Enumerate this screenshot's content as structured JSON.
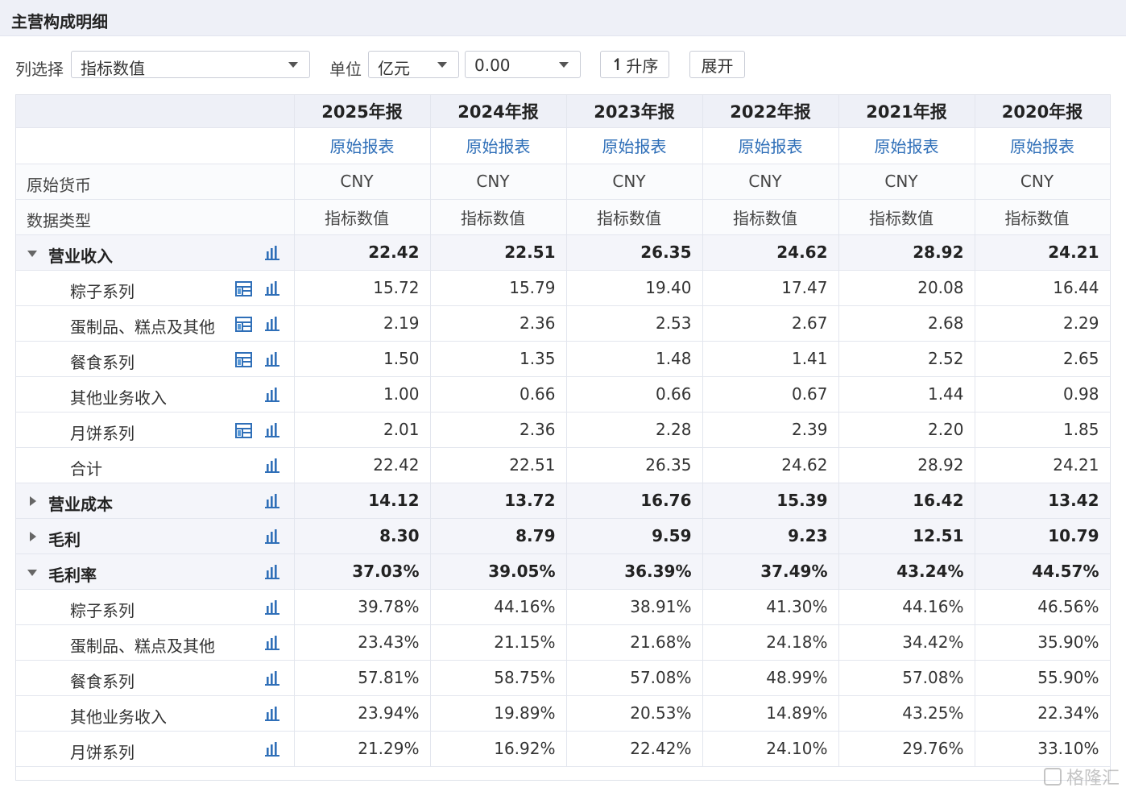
{
  "page_title": "主营构成明细",
  "toolbar": {
    "column_label": "列选择",
    "column_value": "指标数值",
    "unit_label": "单位",
    "unit_value": "亿元",
    "format_value": "0.00",
    "sort_label": "升序",
    "expand_label": "展开"
  },
  "columns": [
    "2025年报",
    "2024年报",
    "2023年报",
    "2022年报",
    "2021年报",
    "2020年报"
  ],
  "link_label": "原始报表",
  "info_rows": [
    {
      "label": "原始货币",
      "values": [
        "CNY",
        "CNY",
        "CNY",
        "CNY",
        "CNY",
        "CNY"
      ]
    },
    {
      "label": "数据类型",
      "values": [
        "指标数值",
        "指标数值",
        "指标数值",
        "指标数值",
        "指标数值",
        "指标数值"
      ]
    }
  ],
  "rows": [
    {
      "kind": "group",
      "toggle": "down",
      "label": "营业收入",
      "pie": false,
      "values": [
        "22.42",
        "22.51",
        "26.35",
        "24.62",
        "28.92",
        "24.21"
      ]
    },
    {
      "kind": "child",
      "label": "粽子系列",
      "pie": true,
      "values": [
        "15.72",
        "15.79",
        "19.40",
        "17.47",
        "20.08",
        "16.44"
      ]
    },
    {
      "kind": "child",
      "label": "蛋制品、糕点及其他",
      "pie": true,
      "values": [
        "2.19",
        "2.36",
        "2.53",
        "2.67",
        "2.68",
        "2.29"
      ]
    },
    {
      "kind": "child",
      "label": "餐食系列",
      "pie": true,
      "values": [
        "1.50",
        "1.35",
        "1.48",
        "1.41",
        "2.52",
        "2.65"
      ]
    },
    {
      "kind": "child",
      "label": "其他业务收入",
      "pie": false,
      "values": [
        "1.00",
        "0.66",
        "0.66",
        "0.67",
        "1.44",
        "0.98"
      ]
    },
    {
      "kind": "child",
      "label": "月饼系列",
      "pie": true,
      "values": [
        "2.01",
        "2.36",
        "2.28",
        "2.39",
        "2.20",
        "1.85"
      ]
    },
    {
      "kind": "child",
      "label": "合计",
      "pie": false,
      "values": [
        "22.42",
        "22.51",
        "26.35",
        "24.62",
        "28.92",
        "24.21"
      ]
    },
    {
      "kind": "group",
      "toggle": "right",
      "label": "营业成本",
      "pie": false,
      "values": [
        "14.12",
        "13.72",
        "16.76",
        "15.39",
        "16.42",
        "13.42"
      ]
    },
    {
      "kind": "group",
      "toggle": "right",
      "label": "毛利",
      "pie": false,
      "values": [
        "8.30",
        "8.79",
        "9.59",
        "9.23",
        "12.51",
        "10.79"
      ]
    },
    {
      "kind": "group",
      "toggle": "down",
      "label": "毛利率",
      "pie": false,
      "values": [
        "37.03%",
        "39.05%",
        "36.39%",
        "37.49%",
        "43.24%",
        "44.57%"
      ]
    },
    {
      "kind": "child",
      "label": "粽子系列",
      "pie": false,
      "values": [
        "39.78%",
        "44.16%",
        "38.91%",
        "41.30%",
        "44.16%",
        "46.56%"
      ]
    },
    {
      "kind": "child",
      "label": "蛋制品、糕点及其他",
      "pie": false,
      "values": [
        "23.43%",
        "21.15%",
        "21.68%",
        "24.18%",
        "34.42%",
        "35.90%"
      ]
    },
    {
      "kind": "child",
      "label": "餐食系列",
      "pie": false,
      "values": [
        "57.81%",
        "58.75%",
        "57.08%",
        "48.99%",
        "57.08%",
        "55.90%"
      ]
    },
    {
      "kind": "child",
      "label": "其他业务收入",
      "pie": false,
      "values": [
        "23.94%",
        "19.89%",
        "20.53%",
        "14.89%",
        "43.25%",
        "22.34%"
      ]
    },
    {
      "kind": "child",
      "label": "月饼系列",
      "pie": false,
      "values": [
        "21.29%",
        "16.92%",
        "22.42%",
        "24.10%",
        "29.76%",
        "33.10%"
      ]
    }
  ],
  "watermark": "格隆汇",
  "colors": {
    "link": "#2f6fb8",
    "icon": "#2f6fb8",
    "header_bg": "#eef0f7"
  },
  "icons": {
    "chart": "bar-chart-icon",
    "pie": "composition-icon"
  }
}
